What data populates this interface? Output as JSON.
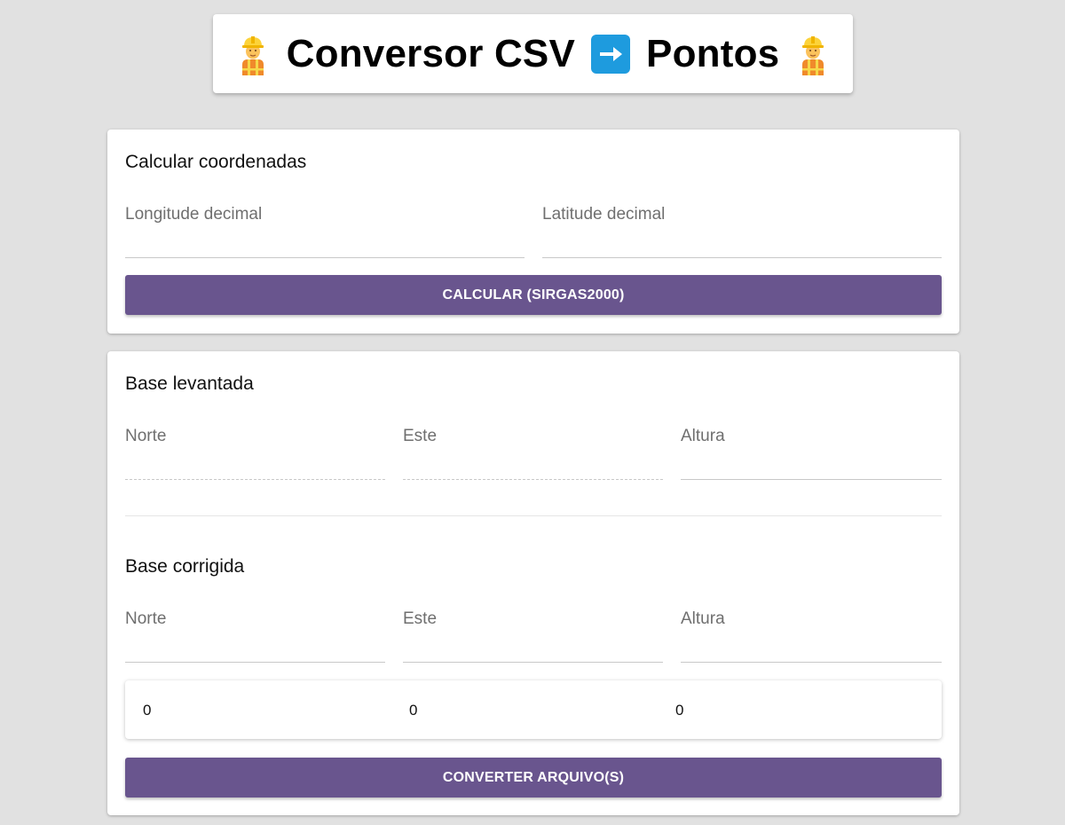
{
  "header": {
    "title_left": "Conversor CSV",
    "title_right": "Pontos",
    "left_icon": "construction-worker-icon",
    "arrow_icon": "right-arrow-icon",
    "right_icon": "construction-worker-icon"
  },
  "coordinates_card": {
    "heading": "Calcular coordenadas",
    "longitude_placeholder": "Longitude decimal",
    "latitude_placeholder": "Latitude decimal",
    "calculate_button": "CALCULAR (SIRGAS2000)"
  },
  "base_card": {
    "surveyed_heading": "Base levantada",
    "surveyed_fields": {
      "north": "Norte",
      "east": "Este",
      "height": "Altura"
    },
    "corrected_heading": "Base corrigida",
    "corrected_fields": {
      "north": "Norte",
      "east": "Este",
      "height": "Altura"
    },
    "difference_values": [
      "0",
      "0",
      "0"
    ],
    "convert_button": "CONVERTER ARQUIVO(S)"
  },
  "colors": {
    "background": "#e1e1e1",
    "button": "#69558e",
    "arrow_box": "#1e9bde"
  }
}
